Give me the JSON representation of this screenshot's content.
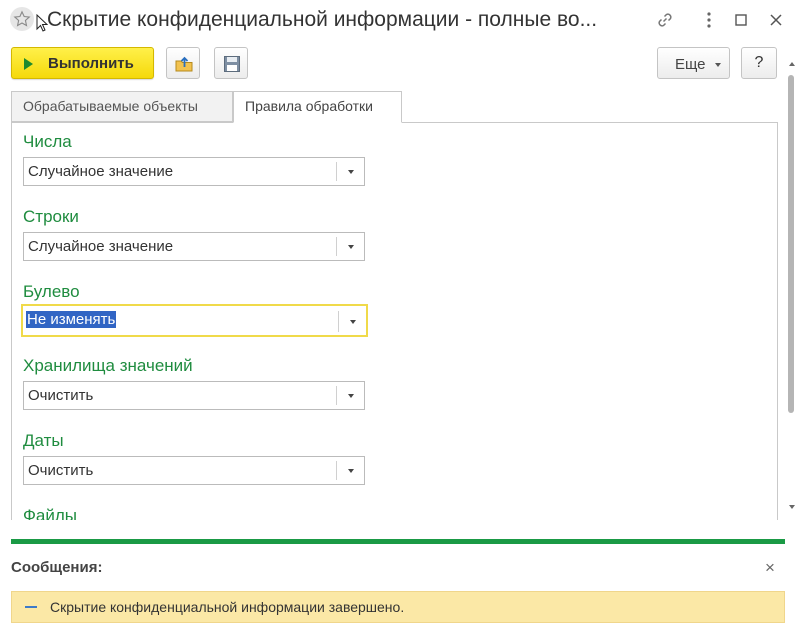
{
  "window": {
    "title": "Скрытие конфиденциальной информации - полные во..."
  },
  "toolbar": {
    "run_label": "Выполнить",
    "more_label": "Еще",
    "help_label": "?"
  },
  "tabs": [
    {
      "label": "Обрабатываемые объекты",
      "active": false
    },
    {
      "label": "Правила обработки",
      "active": true
    }
  ],
  "fields": [
    {
      "label": "Числа",
      "value": "Случайное значение"
    },
    {
      "label": "Строки",
      "value": "Случайное значение"
    },
    {
      "label": "Булево",
      "value": "Не изменять",
      "focused": true
    },
    {
      "label": "Хранилища значений",
      "value": "Очистить"
    },
    {
      "label": "Даты",
      "value": "Очистить"
    },
    {
      "label": "Файлы"
    }
  ],
  "messages": {
    "title": "Сообщения:",
    "close_glyph": "×",
    "items": [
      {
        "text": "Скрытие конфиденциальной информации завершено."
      }
    ]
  },
  "colors": {
    "accent_green": "#1f8c3f",
    "run_button_yellow": "#f5d90a",
    "focus_border": "#f0da4a",
    "selection_blue": "#3165c4",
    "message_background": "#fbe8a6"
  },
  "icons": [
    "star-icon",
    "link-icon",
    "more-vertical-icon",
    "maximize-icon",
    "close-icon",
    "play-icon",
    "upload-folder-icon",
    "save-icon",
    "dropdown-arrow-icon",
    "scroll-up-icon",
    "scroll-down-icon",
    "dash-icon"
  ]
}
